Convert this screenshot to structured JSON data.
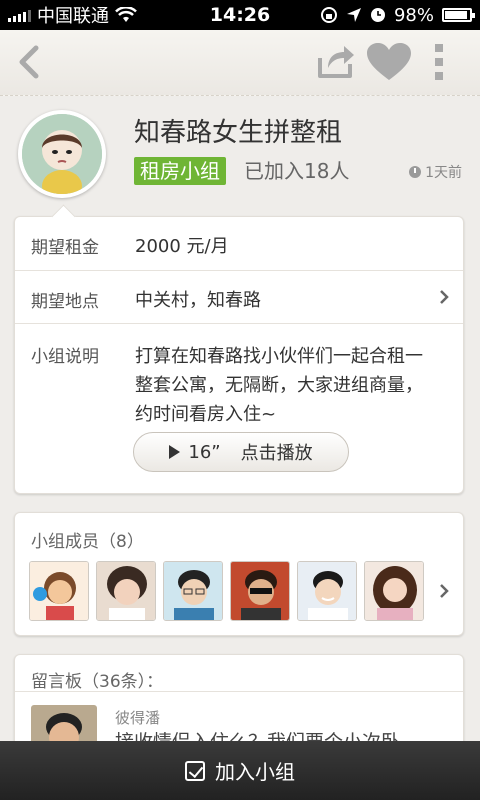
{
  "status_bar": {
    "carrier": "中国联通",
    "time": "14:26",
    "battery": "98%"
  },
  "nav": {
    "back_icon": "back-arrow-icon",
    "share_icon": "share-icon",
    "favorite_icon": "heart-icon",
    "more_icon": "more-vertical-icon"
  },
  "group": {
    "title": "知春路女生拼整租",
    "tag": "租房小组",
    "joined": "已加入18人",
    "time_ago": "1天前",
    "tag_color": "#6fb535"
  },
  "details": {
    "rent_label": "期望租金",
    "rent_value": "2000 元/月",
    "location_label": "期望地点",
    "location_value": "中关村，知春路",
    "desc_label": "小组说明",
    "desc_text": "打算在知春路找小伙伴们一起合租一整套公寓，无隔断，大家进组商量，约时间看房入住~",
    "voice_duration": "16”",
    "voice_label": "点击播放"
  },
  "members": {
    "title": "小组成员（8）",
    "avatars": [
      "member-avatar-1",
      "member-avatar-2",
      "member-avatar-3",
      "member-avatar-4",
      "member-avatar-5",
      "member-avatar-6"
    ]
  },
  "board": {
    "title": "留言板（36条）：",
    "comment": {
      "author": "彼得潘",
      "text": "接收情侣入住么？我们要个小次卧"
    }
  },
  "bottom": {
    "join_label": "加入小组"
  }
}
